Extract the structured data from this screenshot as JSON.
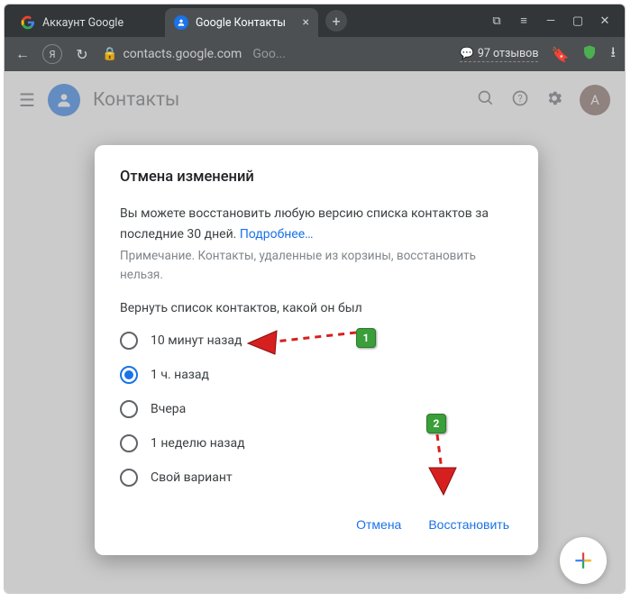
{
  "tabs": [
    {
      "title": "Аккаунт Google"
    },
    {
      "title": "Google Контакты"
    }
  ],
  "addressbar": {
    "url_host": "contacts.google.com",
    "url_title": "Goo...",
    "reviews": "97 отзывов"
  },
  "app": {
    "title": "Контакты",
    "avatar_letter": "A"
  },
  "dialog": {
    "title": "Отмена изменений",
    "text1": "Вы можете восстановить любую версию списка контактов за последние 30 дней. ",
    "learn_more": "Подробнее…",
    "note": "Примечание. Контакты, удаленные из корзины, восстановить нельзя.",
    "subtitle": "Вернуть список контактов, какой он был",
    "options": {
      "o0": "10 минут назад",
      "o1": "1 ч. назад",
      "o2": "Вчера",
      "o3": "1 неделю назад",
      "o4": "Свой вариант"
    },
    "cancel": "Отмена",
    "restore": "Восстановить"
  },
  "markers": {
    "m1": "1",
    "m2": "2"
  }
}
